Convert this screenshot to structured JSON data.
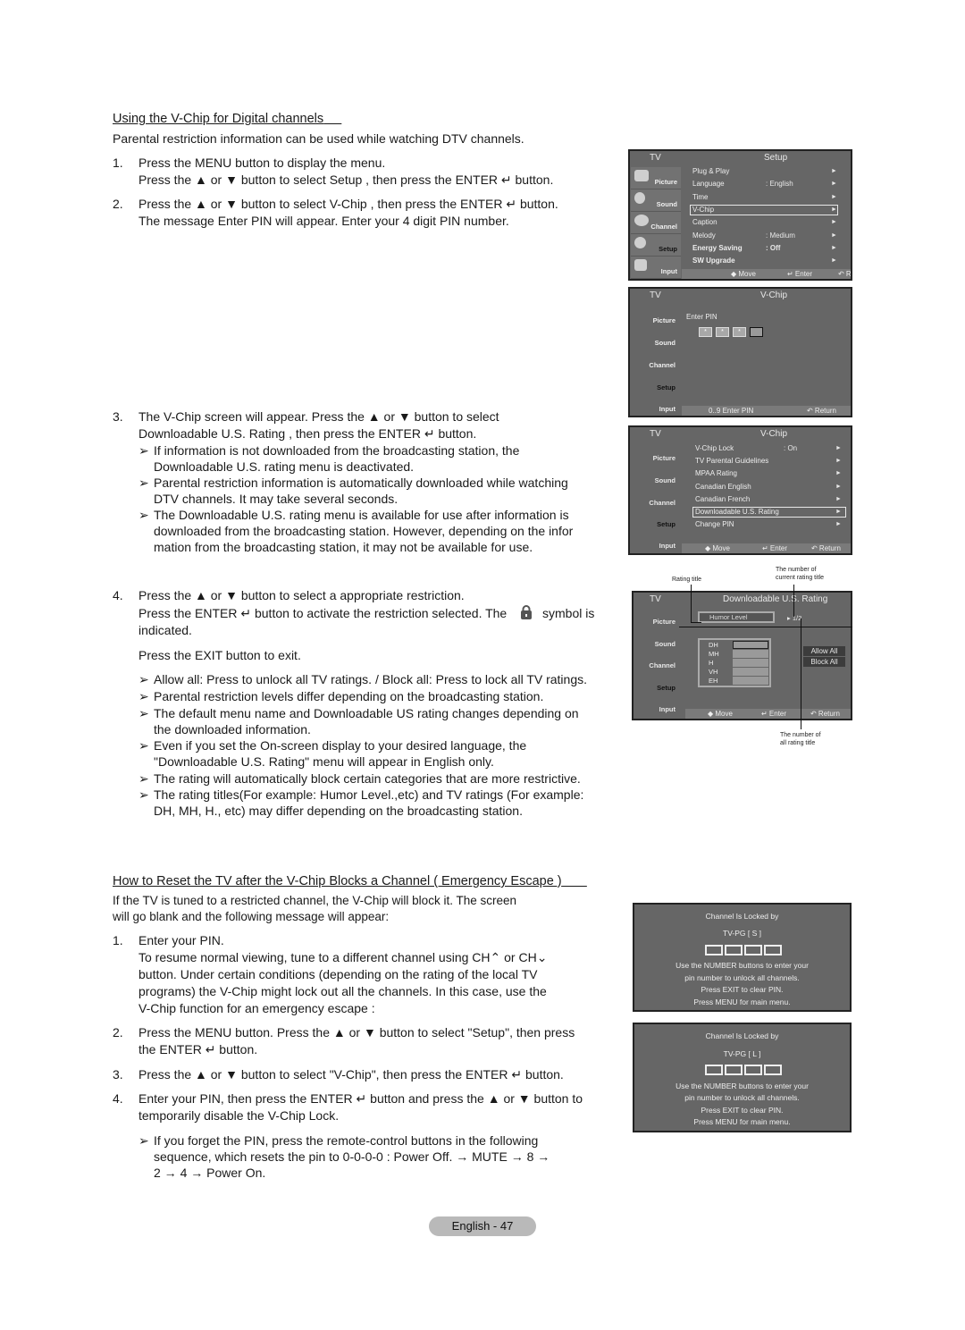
{
  "section1": {
    "title": "Using the V-Chip for Digital channels",
    "intro": "Parental restriction information can be used while watching DTV channels.",
    "steps": [
      {
        "num": "1.",
        "lines": [
          "Press the MENU button to display the menu.",
          "Press the ▲ or ▼ button to select  Setup , then press the  ENTER ↵ button."
        ]
      },
      {
        "num": "2.",
        "lines": [
          "Press the ▲ or ▼ button to select  V-Chip , then press the ENTER ↵ button.",
          "The message  Enter PIN  will appear. Enter your 4 digit PIN number."
        ]
      },
      {
        "num": "3.",
        "lines": [
          "The  V-Chip  screen will appear. Press the ▲ or ▼ button to select",
          " Downloadable U.S. Rating , then press the ENTER ↵ button."
        ],
        "notes": [
          [
            "If information is not downloaded from the broadcasting station, the",
            "Downloadable U.S. rating menu is deactivated."
          ],
          [
            "Parental restriction information is automatically downloaded while watching",
            "DTV channels. It may take several seconds."
          ],
          [
            "The Downloadable U.S. rating menu is available for use after information is",
            "downloaded from the broadcasting station. However, depending on the infor",
            "mation from the broadcasting station, it may not be available for use."
          ]
        ]
      },
      {
        "num": "4.",
        "lines": [
          "Press the ▲ or ▼ button to select a appropriate restriction.",
          "Press the ENTER ↵ button to activate the restriction selected. The",
          "indicated."
        ],
        "symbol_suffix": "symbol is",
        "exit": "Press the EXIT button to exit.",
        "notes": [
          [
            "Allow all: Press to unlock all TV ratings. / Block all: Press to lock all TV ratings."
          ],
          [
            "Parental restriction levels differ depending on the broadcasting station."
          ],
          [
            "The default menu name and Downloadable US rating changes depending on",
            "the downloaded information."
          ],
          [
            "Even if you set the On-screen display to your desired language, the",
            "\"Downloadable U.S. Rating\" menu will appear in English only."
          ],
          [
            "The rating will automatically block certain categories that are more restrictive."
          ],
          [
            "The rating titles(For example: Humor Level.,etc) and TV ratings (For example:",
            "DH, MH, H., etc) may differ depending on the broadcasting station."
          ]
        ]
      }
    ]
  },
  "section2": {
    "title": "How to Reset the TV after the V-Chip Blocks a Channel ( Emergency Escape )",
    "intro": [
      "If the TV is tuned to a restricted channel, the V-Chip will block it. The screen",
      "will go blank and the following message will appear:"
    ],
    "steps": [
      {
        "num": "1.",
        "lines": [
          "Enter your PIN.",
          "To resume normal viewing, tune to a different channel using CH⌃ or CH⌄",
          "button. Under certain conditions (depending on the rating of the local TV",
          "programs) the V-Chip might lock out all the channels. In this case, use the",
          "V-Chip function for an  emergency escape :"
        ]
      },
      {
        "num": "2.",
        "lines": [
          "Press the MENU button. Press the ▲ or ▼ button to select \"Setup\", then press",
          "the ENTER ↵ button."
        ]
      },
      {
        "num": "3.",
        "lines": [
          "Press the ▲ or ▼ button to select \"V-Chip\", then press the ENTER ↵ button."
        ]
      },
      {
        "num": "4.",
        "lines": [
          "Enter your PIN, then press the ENTER ↵ button and press the ▲ or ▼ button to",
          "temporarily disable the V-Chip Lock."
        ],
        "notes": [
          [
            "If you forget the PIN, press the remote-control buttons in the following",
            "sequence, which resets the pin to 0-0-0-0 : Power Off. → MUTE → 8 →",
            "2 → 4 → Power On."
          ]
        ]
      }
    ]
  },
  "note_arrow": "➢",
  "osd_common": {
    "tv_label": "TV",
    "sidebar": [
      "Picture",
      "Sound",
      "Channel",
      "Setup",
      "Input"
    ],
    "move": "◆ Move",
    "enter": "↵ Enter",
    "return": "↶ Return"
  },
  "screen_setup": {
    "title": "Setup",
    "items": [
      {
        "label": "Plug & Play",
        "value": ""
      },
      {
        "label": "Language",
        "value": ": English"
      },
      {
        "label": "Time",
        "value": ""
      },
      {
        "label": "V-Chip",
        "value": "",
        "selected": true
      },
      {
        "label": "Caption",
        "value": ""
      },
      {
        "label": "Melody",
        "value": ": Medium"
      },
      {
        "label": "Energy Saving",
        "value": ": Off",
        "bold": true
      },
      {
        "label": "SW Upgrade",
        "value": "",
        "bold": true
      }
    ],
    "arrow": "►"
  },
  "screen_pin": {
    "title": "V-Chip",
    "prompt": "Enter PIN",
    "pin_entered": [
      "*",
      "*",
      "*"
    ],
    "footer_hint": "0..9 Enter PIN"
  },
  "screen_vchip": {
    "title": "V-Chip",
    "items": [
      {
        "label": "V-Chip Lock",
        "value": ": On"
      },
      {
        "label": "TV Parental Guidelines",
        "value": ""
      },
      {
        "label": "MPAA Rating",
        "value": ""
      },
      {
        "label": "Canadian English",
        "value": ""
      },
      {
        "label": "Canadian French",
        "value": ""
      },
      {
        "label": "Downloadable U.S. Rating",
        "value": "",
        "selected": true
      },
      {
        "label": "Change PIN",
        "value": ""
      }
    ]
  },
  "screen_download": {
    "title": "Downloadable U.S. Rating",
    "rating_title": "Humor Level",
    "page": "▸ 1/2",
    "ratings": [
      "DH",
      "MH",
      "H",
      "VH",
      "EH"
    ],
    "allow_all": "Allow All",
    "block_all": "Block All",
    "callouts": {
      "rating_title": "Rating title",
      "current": [
        "The number of",
        "current rating title"
      ],
      "all": [
        "The number of",
        "all rating title"
      ]
    }
  },
  "lock_screens": [
    {
      "line1": "Channel Is Locked by",
      "rating": "TV-PG [ S ]",
      "msg": [
        "Use the NUMBER buttons to enter your",
        "pin number to unlock all channels.",
        "Press EXIT to clear PIN.",
        "Press MENU for main menu."
      ]
    },
    {
      "line1": "Channel Is Locked by",
      "rating": "TV-PG [ L ]",
      "msg": [
        "Use the NUMBER buttons to enter your",
        "pin number to unlock all channels.",
        "Press EXIT to clear PIN.",
        "Press MENU for main menu."
      ]
    }
  ],
  "footer": {
    "page_label": "English - 47"
  }
}
